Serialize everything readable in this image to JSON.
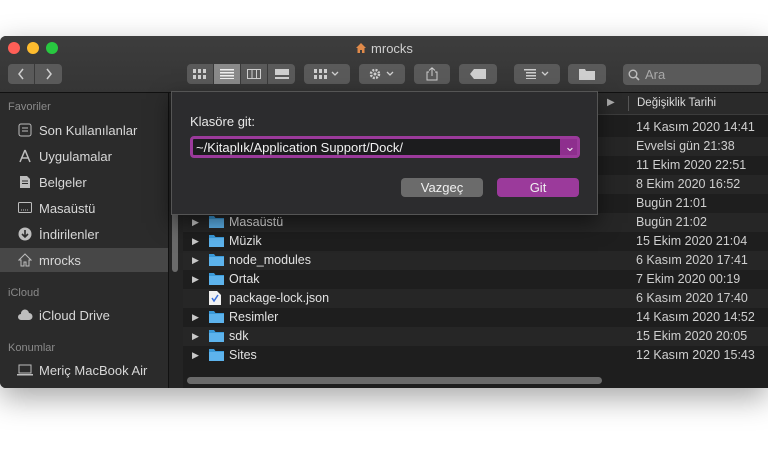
{
  "window": {
    "title": "mrocks"
  },
  "toolbar": {
    "search_placeholder": "Ara"
  },
  "sidebar": {
    "sections": [
      {
        "label": "Favoriler",
        "items": [
          {
            "label": "Son Kullanılanlar",
            "icon": "clock-icon"
          },
          {
            "label": "Uygulamalar",
            "icon": "applications-icon"
          },
          {
            "label": "Belgeler",
            "icon": "document-icon"
          },
          {
            "label": "Masaüstü",
            "icon": "desktop-icon"
          },
          {
            "label": "İndirilenler",
            "icon": "download-icon"
          },
          {
            "label": "mrocks",
            "icon": "home-icon",
            "selected": true
          }
        ]
      },
      {
        "label": "iCloud",
        "items": [
          {
            "label": "iCloud Drive",
            "icon": "cloud-icon"
          }
        ]
      },
      {
        "label": "Konumlar",
        "items": [
          {
            "label": "Meriç MacBook Air",
            "icon": "laptop-icon"
          }
        ]
      }
    ]
  },
  "columns": {
    "date": "Değişiklik Tarihi"
  },
  "hidden_dates": [
    "14 Kasım 2020 14:41",
    "Evvelsi gün 21:38",
    "11 Ekim 2020 22:51",
    "8 Ekim 2020 16:52",
    "Bugün 21:01"
  ],
  "files": [
    {
      "name": "Masaüstü",
      "date": "Bugün 21:02",
      "type": "folder"
    },
    {
      "name": "Müzik",
      "date": "15 Ekim 2020 21:04",
      "type": "folder"
    },
    {
      "name": "node_modules",
      "date": "6 Kasım 2020 17:41",
      "type": "folder"
    },
    {
      "name": "Ortak",
      "date": "7 Ekim 2020 00:19",
      "type": "folder"
    },
    {
      "name": "package-lock.json",
      "date": "6 Kasım 2020 17:40",
      "type": "file"
    },
    {
      "name": "Resimler",
      "date": "14 Kasım 2020 14:52",
      "type": "folder"
    },
    {
      "name": "sdk",
      "date": "15 Ekim 2020 20:05",
      "type": "folder"
    },
    {
      "name": "Sites",
      "date": "12 Kasım 2020 15:43",
      "type": "folder"
    }
  ],
  "dialog": {
    "label": "Klasöre git:",
    "path": "~/Kitaplık/Application Support/Dock/",
    "cancel": "Vazgeç",
    "go": "Git"
  },
  "colors": {
    "accent": "#9b3a9b",
    "folder": "#3a9ad9"
  }
}
